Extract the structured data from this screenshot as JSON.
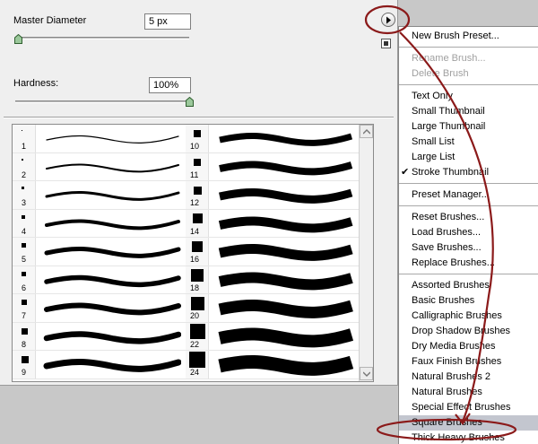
{
  "panel": {
    "master_diameter_label": "Master Diameter",
    "master_diameter_value": "5 px",
    "hardness_label": "Hardness:",
    "hardness_value": "100%"
  },
  "brushes": [
    {
      "size": "1",
      "stroke_w": 1.2
    },
    {
      "size": "10",
      "stroke_w": 7
    },
    {
      "size": "2",
      "stroke_w": 2
    },
    {
      "size": "11",
      "stroke_w": 8
    },
    {
      "size": "3",
      "stroke_w": 3
    },
    {
      "size": "12",
      "stroke_w": 9
    },
    {
      "size": "4",
      "stroke_w": 4
    },
    {
      "size": "14",
      "stroke_w": 10
    },
    {
      "size": "5",
      "stroke_w": 5
    },
    {
      "size": "16",
      "stroke_w": 11
    },
    {
      "size": "6",
      "stroke_w": 5.5
    },
    {
      "size": "18",
      "stroke_w": 12
    },
    {
      "size": "7",
      "stroke_w": 6
    },
    {
      "size": "20",
      "stroke_w": 13
    },
    {
      "size": "8",
      "stroke_w": 6.5
    },
    {
      "size": "22",
      "stroke_w": 14
    },
    {
      "size": "9",
      "stroke_w": 7
    },
    {
      "size": "24",
      "stroke_w": 15
    }
  ],
  "menu": {
    "items": [
      {
        "label": "New Brush Preset...",
        "disabled": false,
        "checked": false,
        "highlight": false
      },
      {
        "sep": true
      },
      {
        "label": "Rename Brush...",
        "disabled": true,
        "checked": false,
        "highlight": false
      },
      {
        "label": "Delete Brush",
        "disabled": true,
        "checked": false,
        "highlight": false
      },
      {
        "sep": true
      },
      {
        "label": "Text Only",
        "disabled": false,
        "checked": false,
        "highlight": false
      },
      {
        "label": "Small Thumbnail",
        "disabled": false,
        "checked": false,
        "highlight": false
      },
      {
        "label": "Large Thumbnail",
        "disabled": false,
        "checked": false,
        "highlight": false
      },
      {
        "label": "Small List",
        "disabled": false,
        "checked": false,
        "highlight": false
      },
      {
        "label": "Large List",
        "disabled": false,
        "checked": false,
        "highlight": false
      },
      {
        "label": "Stroke Thumbnail",
        "disabled": false,
        "checked": true,
        "highlight": false
      },
      {
        "sep": true
      },
      {
        "label": "Preset Manager...",
        "disabled": false,
        "checked": false,
        "highlight": false
      },
      {
        "sep": true
      },
      {
        "label": "Reset Brushes...",
        "disabled": false,
        "checked": false,
        "highlight": false
      },
      {
        "label": "Load Brushes...",
        "disabled": false,
        "checked": false,
        "highlight": false
      },
      {
        "label": "Save Brushes...",
        "disabled": false,
        "checked": false,
        "highlight": false
      },
      {
        "label": "Replace Brushes...",
        "disabled": false,
        "checked": false,
        "highlight": false
      },
      {
        "sep": true
      },
      {
        "label": "Assorted Brushes",
        "disabled": false,
        "checked": false,
        "highlight": false
      },
      {
        "label": "Basic Brushes",
        "disabled": false,
        "checked": false,
        "highlight": false
      },
      {
        "label": "Calligraphic Brushes",
        "disabled": false,
        "checked": false,
        "highlight": false
      },
      {
        "label": "Drop Shadow Brushes",
        "disabled": false,
        "checked": false,
        "highlight": false
      },
      {
        "label": "Dry Media Brushes",
        "disabled": false,
        "checked": false,
        "highlight": false
      },
      {
        "label": "Faux Finish Brushes",
        "disabled": false,
        "checked": false,
        "highlight": false
      },
      {
        "label": "Natural Brushes 2",
        "disabled": false,
        "checked": false,
        "highlight": false
      },
      {
        "label": "Natural Brushes",
        "disabled": false,
        "checked": false,
        "highlight": false
      },
      {
        "label": "Special Effect Brushes",
        "disabled": false,
        "checked": false,
        "highlight": false
      },
      {
        "label": "Square Brushes",
        "disabled": false,
        "checked": false,
        "highlight": true
      },
      {
        "label": "Thick Heavy Brushes",
        "disabled": false,
        "checked": false,
        "highlight": false
      }
    ]
  },
  "colors": {
    "annotation": "#8b1a1a",
    "highlight": "#c3c6cf"
  },
  "icons": {
    "flyout": "right-arrow-circle-icon",
    "check": "checkmark-icon"
  }
}
